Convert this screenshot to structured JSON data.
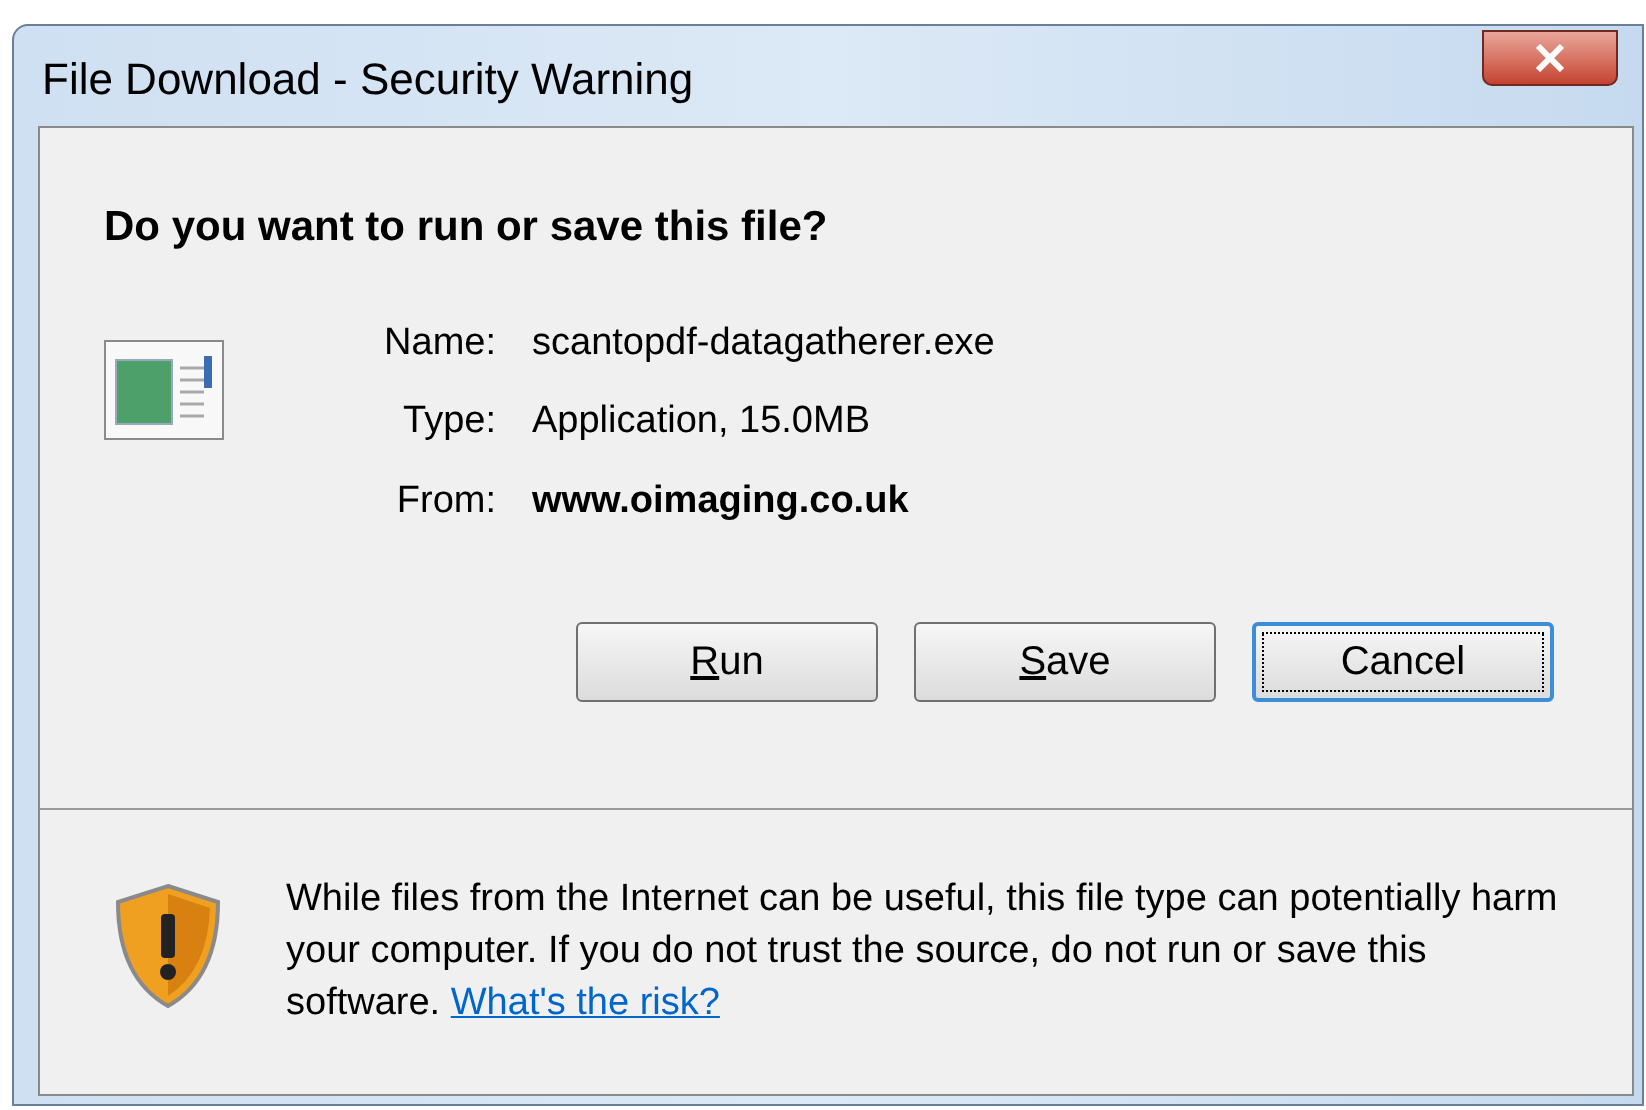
{
  "window": {
    "title": "File Download - Security Warning"
  },
  "heading": "Do you want to run or save this file?",
  "fields": [
    {
      "label": "Name:",
      "value": "scantopdf-datagatherer.exe",
      "bold": false
    },
    {
      "label": "Type:",
      "value": "Application, 15.0MB",
      "bold": false
    },
    {
      "label": "From:",
      "value": "www.oimaging.co.uk",
      "bold": true
    }
  ],
  "buttons": [
    {
      "label": "Run",
      "underline_first": true,
      "focused": false
    },
    {
      "label": "Save",
      "underline_first": true,
      "focused": false
    },
    {
      "label": "Cancel",
      "underline_first": false,
      "focused": true
    }
  ],
  "warning": {
    "text": "While files from the Internet can be useful, this file type can potentially harm your computer. If you do not trust the source, do not run or save this software.",
    "link": "What's the risk?"
  }
}
